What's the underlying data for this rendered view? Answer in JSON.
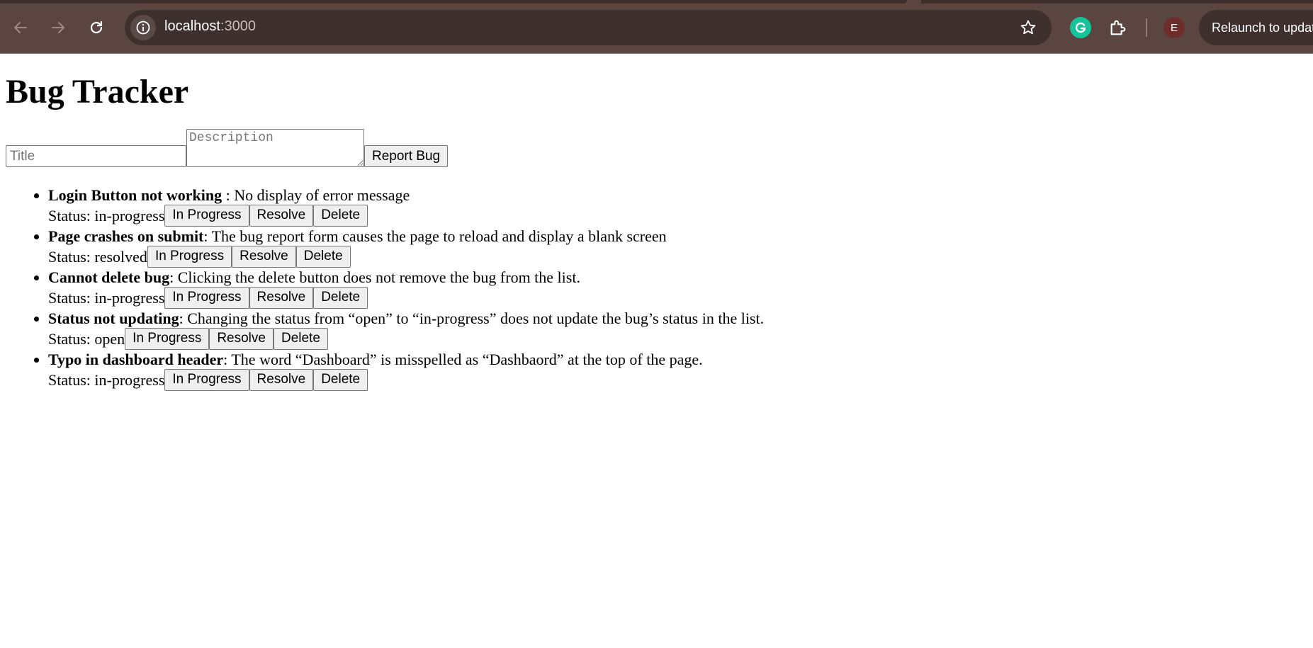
{
  "browser": {
    "url_host": "localhost",
    "url_port": ":3000",
    "profile_initial": "E",
    "relaunch_label": "Relaunch to update"
  },
  "page": {
    "title": "Bug Tracker",
    "form": {
      "title_placeholder": "Title",
      "description_placeholder": "Description",
      "submit_label": "Report Bug"
    },
    "status_prefix": "Status: ",
    "button_labels": {
      "in_progress": "In Progress",
      "resolve": "Resolve",
      "delete": "Delete"
    },
    "bugs": [
      {
        "title": "Login Button not working ",
        "description": ": No display of error message",
        "status": "in-progress"
      },
      {
        "title": "Page crashes on submit",
        "description": ": The bug report form causes the page to reload and display a blank screen",
        "status": "resolved"
      },
      {
        "title": "Cannot delete bug",
        "description": ": Clicking the delete button does not remove the bug from the list.",
        "status": "in-progress"
      },
      {
        "title": "Status not updating",
        "description": ": Changing the status from “open” to “in-progress” does not update the bug’s status in the list.",
        "status": "open"
      },
      {
        "title": "Typo in dashboard header",
        "description": ": The word “Dashboard” is misspelled as “Dashbaord” at the top of the page.",
        "status": "in-progress"
      }
    ]
  }
}
